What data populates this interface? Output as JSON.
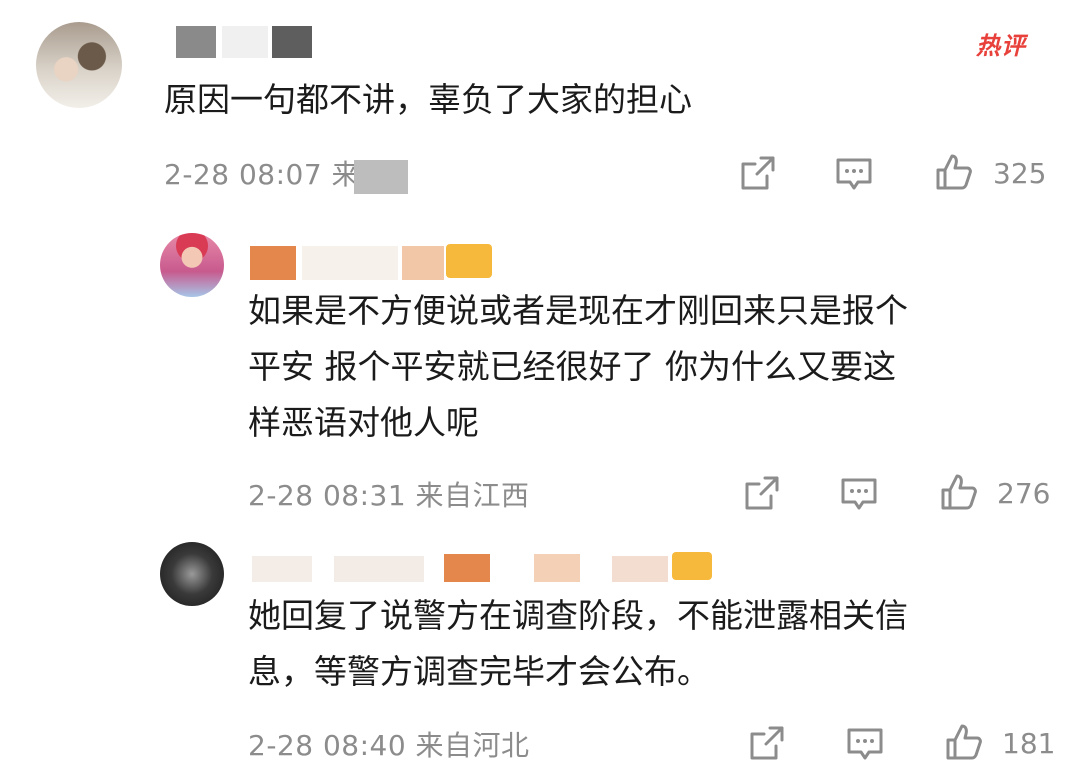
{
  "badge": {
    "hot_label": "热评"
  },
  "comments": [
    {
      "text": "原因一句都不讲，辜负了大家的担心",
      "meta": "2-28 08:07 来自",
      "likes": "325",
      "icons": [
        "share-icon",
        "reply-icon",
        "thumbs-up-icon"
      ]
    },
    {
      "text": "如果是不方便说或者是现在才刚回来只是报个\n平安  报个平安就已经很好了  你为什么又要这\n样恶语对他人呢",
      "meta": "2-28 08:31 来自江西",
      "likes": "276",
      "icons": [
        "share-icon",
        "reply-icon",
        "thumbs-up-icon"
      ]
    },
    {
      "text": "她回复了说警方在调查阶段，不能泄露相关信\n息，等警方调查完毕才会公布。",
      "meta": "2-28 08:40 来自河北",
      "likes": "181",
      "icons": [
        "share-icon",
        "reply-icon",
        "thumbs-up-icon"
      ]
    }
  ],
  "colors": {
    "text": "#1b1b1b",
    "meta": "#8c8c8c",
    "hot": "#e8413c"
  }
}
